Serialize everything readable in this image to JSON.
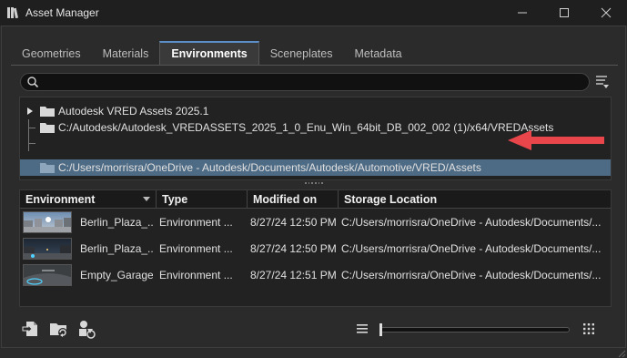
{
  "window": {
    "title": "Asset Manager",
    "controls": [
      "minimize",
      "maximize",
      "close"
    ]
  },
  "tabs": [
    {
      "label": "Geometries",
      "active": false
    },
    {
      "label": "Materials",
      "active": false
    },
    {
      "label": "Environments",
      "active": true
    },
    {
      "label": "Sceneplates",
      "active": false
    },
    {
      "label": "Metadata",
      "active": false
    }
  ],
  "search": {
    "value": "",
    "placeholder": ""
  },
  "tree": {
    "items": [
      {
        "label": "Autodesk VRED Assets 2025.1",
        "expandable": true,
        "selected": false
      },
      {
        "label": "C:/Autodesk/Autodesk_VREDASSETS_2025_1_0_Enu_Win_64bit_DB_002_002 (1)/x64/VREDAssets",
        "expandable": false,
        "selected": false
      },
      {
        "label": "C:/Users/morrisra/OneDrive - Autodesk/Documents/Autodesk/Automotive/VRED/Assets",
        "expandable": false,
        "selected": true
      }
    ]
  },
  "table": {
    "columns": [
      "Environment",
      "Type",
      "Modified on",
      "Storage Location"
    ],
    "sorted_column": "Environment",
    "rows": [
      {
        "name": "Berlin_Plaza_...",
        "type": "Environment ...",
        "modified": "8/27/24 12:50 PM",
        "location": "C:/Users/morrisra/OneDrive - Autodesk/Documents/..."
      },
      {
        "name": "Berlin_Plaza_...",
        "type": "Environment ...",
        "modified": "8/27/24 12:50 PM",
        "location": "C:/Users/morrisra/OneDrive - Autodesk/Documents/..."
      },
      {
        "name": "Empty_Garage",
        "type": "Environment ...",
        "modified": "8/27/24 12:51 PM",
        "location": "C:/Users/morrisra/OneDrive - Autodesk/Documents/..."
      }
    ]
  },
  "toolbar": {
    "icons": [
      "import-file-icon",
      "refresh-folder-icon",
      "sync-assets-icon",
      "list-view-icon",
      "grid-view-icon"
    ],
    "thumbnail_size": 0
  },
  "colors": {
    "selection": "#4e6b85",
    "tab_accent": "#5b8fc9",
    "annotation_arrow": "#e8464b"
  }
}
